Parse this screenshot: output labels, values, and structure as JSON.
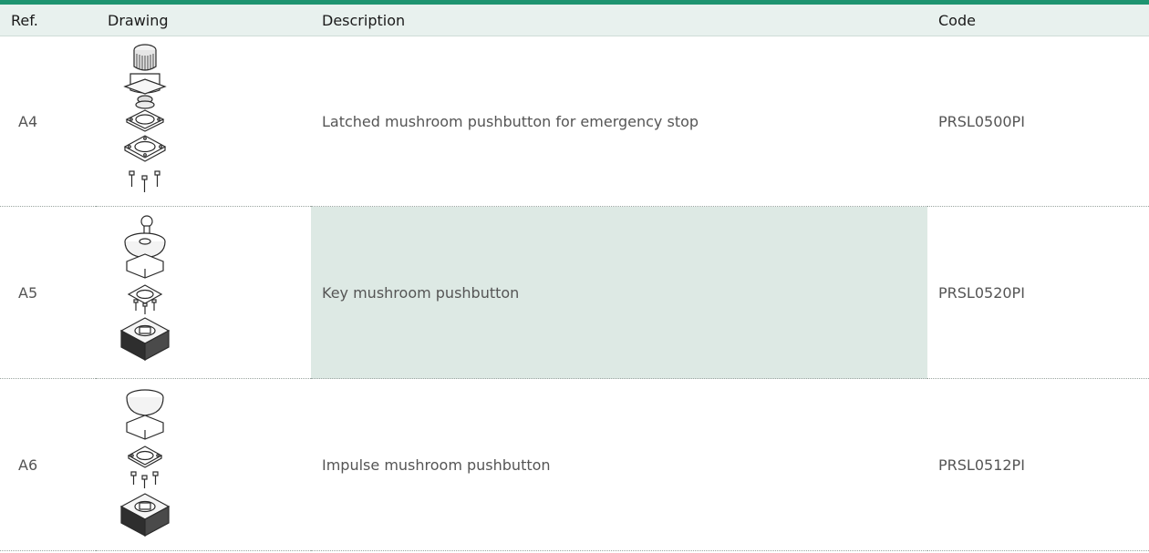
{
  "colors": {
    "accent": "#1e9470",
    "header_bg": "#e8f1ee",
    "highlight_bg": "#dde9e4"
  },
  "header": {
    "ref": "Ref.",
    "drawing": "Drawing",
    "description": "Description",
    "code": "Code"
  },
  "rows": [
    {
      "ref": "A4",
      "drawing_icon": "latched-mushroom-pushbutton-drawing",
      "description": "Latched mushroom pushbutton for emergency stop",
      "code": "PRSL0500PI"
    },
    {
      "ref": "A5",
      "drawing_icon": "key-mushroom-pushbutton-drawing",
      "description": "Key mushroom pushbutton",
      "code": "PRSL0520PI"
    },
    {
      "ref": "A6",
      "drawing_icon": "impulse-mushroom-pushbutton-drawing",
      "description": "Impulse mushroom pushbutton",
      "code": "PRSL0512PI"
    }
  ]
}
